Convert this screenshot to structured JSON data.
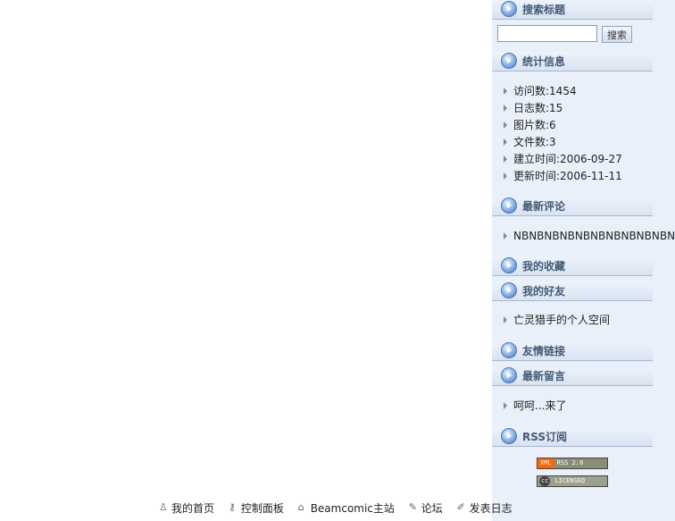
{
  "sidebar": {
    "search": {
      "title": "搜索标题",
      "input_value": "",
      "button_label": "搜索"
    },
    "stats": {
      "title": "统计信息",
      "items": [
        "访问数:1454",
        "日志数:15",
        "图片数:6",
        "文件数:3",
        "建立时间:2006-09-27",
        "更新时间:2006-11-11"
      ]
    },
    "comments": {
      "title": "最新评论",
      "items": [
        "NBNBNBNBNBNBNBNBNBNBN..."
      ]
    },
    "favorites": {
      "title": "我的收藏"
    },
    "friends": {
      "title": "我的好友",
      "items": [
        "亡灵猎手的个人空间"
      ]
    },
    "links": {
      "title": "友情链接"
    },
    "messages": {
      "title": "最新留言",
      "items": [
        "呵呵...来了"
      ]
    },
    "rss": {
      "title": "RSS订阅",
      "rss_badge_left": "XML",
      "rss_badge_right": "RSS 2.0",
      "cc_badge_mark": "cc",
      "cc_badge_text": "LICENSED"
    }
  },
  "footer": {
    "links": [
      "我的首页",
      "控制面板",
      "Beamcomic主站",
      "论坛",
      "发表日志"
    ]
  },
  "colors": {
    "sidebar_bg": "#e9f0fa",
    "header_text": "#445a77",
    "rss_orange": "#ff6600"
  }
}
